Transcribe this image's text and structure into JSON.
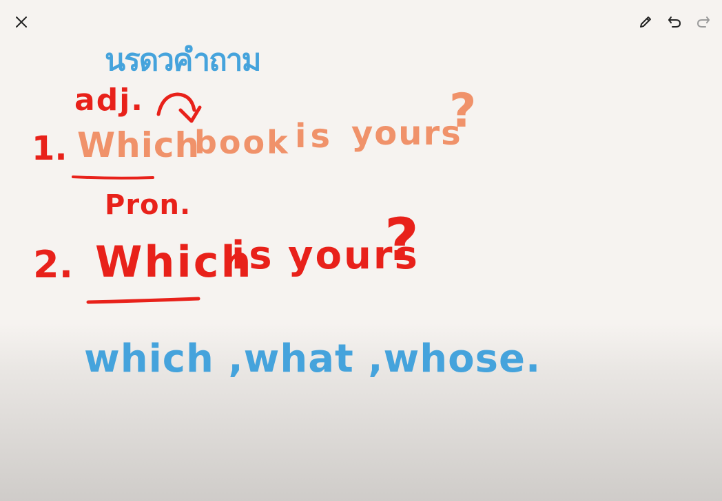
{
  "toolbar": {
    "close_icon": "close-icon",
    "pencil_icon": "pencil-icon",
    "undo_icon": "undo-icon",
    "redo_icon": "redo-icon"
  },
  "notes": {
    "thai_annotation": "นรดวคำถาม",
    "adj_label": "adj.",
    "pron_label": "Pron.",
    "line1": {
      "number": "1.",
      "which": "Which",
      "book": "book",
      "is": "is",
      "yours": "yours",
      "question": "?"
    },
    "line2": {
      "number": "2.",
      "which": "Which",
      "is": "is",
      "yours": "yours",
      "question": "?"
    },
    "bottom_words": "which ,what ,whose."
  },
  "colors": {
    "background": "#f6f3f0",
    "red_ink": "#e8211a",
    "orange_ink": "#f0926a",
    "blue_ink": "#45a3dc",
    "toolbar_icon": "#222222",
    "toolbar_icon_disabled": "#9a9a9a"
  }
}
